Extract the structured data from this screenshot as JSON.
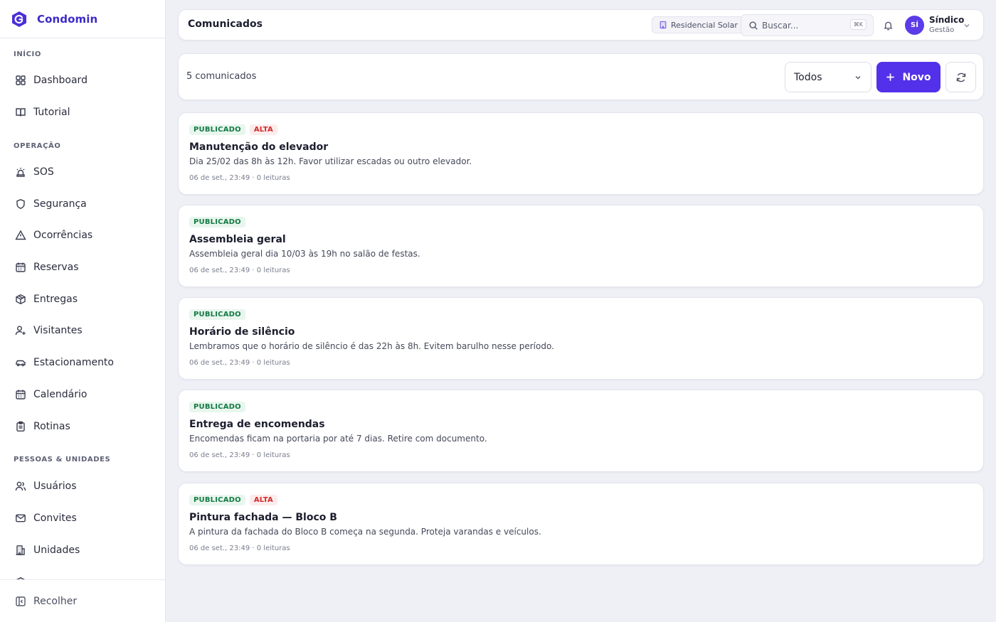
{
  "brand": {
    "name": "Condomin"
  },
  "sidebar": {
    "sections": [
      {
        "title": "INÍCIO",
        "items": [
          {
            "label": "Dashboard",
            "icon": "grid-icon"
          },
          {
            "label": "Tutorial",
            "icon": "book-icon"
          }
        ]
      },
      {
        "title": "OPERAÇÃO",
        "items": [
          {
            "label": "SOS",
            "icon": "siren-icon"
          },
          {
            "label": "Segurança",
            "icon": "shield-icon"
          },
          {
            "label": "Ocorrências",
            "icon": "alert-triangle-icon"
          },
          {
            "label": "Reservas",
            "icon": "calendar-icon"
          },
          {
            "label": "Entregas",
            "icon": "package-icon"
          },
          {
            "label": "Visitantes",
            "icon": "user-plus-icon"
          },
          {
            "label": "Estacionamento",
            "icon": "car-icon"
          },
          {
            "label": "Calendário",
            "icon": "calendar-days-icon"
          },
          {
            "label": "Rotinas",
            "icon": "clipboard-icon"
          }
        ]
      },
      {
        "title": "PESSOAS & UNIDADES",
        "items": [
          {
            "label": "Usuários",
            "icon": "users-icon"
          },
          {
            "label": "Convites",
            "icon": "mail-icon"
          },
          {
            "label": "Unidades",
            "icon": "building-icon"
          }
        ]
      }
    ],
    "collapse_label": "Recolher"
  },
  "header": {
    "title": "Comunicados",
    "condo_chip": "Residencial Solar",
    "search_placeholder": "Buscar...",
    "search_shortcut": "⌘K",
    "user": {
      "initials": "SÍ",
      "name": "Síndico",
      "role": "Gestão"
    }
  },
  "toolbar": {
    "count_label": "5 comunicados",
    "filter_value": "Todos",
    "new_label": "Novo"
  },
  "announcements": [
    {
      "status": "PUBLICADO",
      "priority": "ALTA",
      "title": "Manutenção do elevador",
      "body": "Dia 25/02 das 8h às 12h. Favor utilizar escadas ou outro elevador.",
      "meta": "06 de set., 23:49 · 0 leituras"
    },
    {
      "status": "PUBLICADO",
      "priority": "",
      "title": "Assembleia geral",
      "body": "Assembleia geral dia 10/03 às 19h no salão de festas.",
      "meta": "06 de set., 23:49 · 0 leituras"
    },
    {
      "status": "PUBLICADO",
      "priority": "",
      "title": "Horário de silêncio",
      "body": "Lembramos que o horário de silêncio é das 22h às 8h. Evitem barulho nesse período.",
      "meta": "06 de set., 23:49 · 0 leituras"
    },
    {
      "status": "PUBLICADO",
      "priority": "",
      "title": "Entrega de encomendas",
      "body": "Encomendas ficam na portaria por até 7 dias. Retire com documento.",
      "meta": "06 de set., 23:49 · 0 leituras"
    },
    {
      "status": "PUBLICADO",
      "priority": "ALTA",
      "title": "Pintura fachada — Bloco B",
      "body": "A pintura da fachada do Bloco B começa na segunda. Proteja varandas e veículos.",
      "meta": "06 de set., 23:49 · 0 leituras"
    }
  ],
  "colors": {
    "accent": "#5331ea",
    "brand": "#3c2bc7",
    "published": "#157a44",
    "high": "#d12b2b"
  }
}
